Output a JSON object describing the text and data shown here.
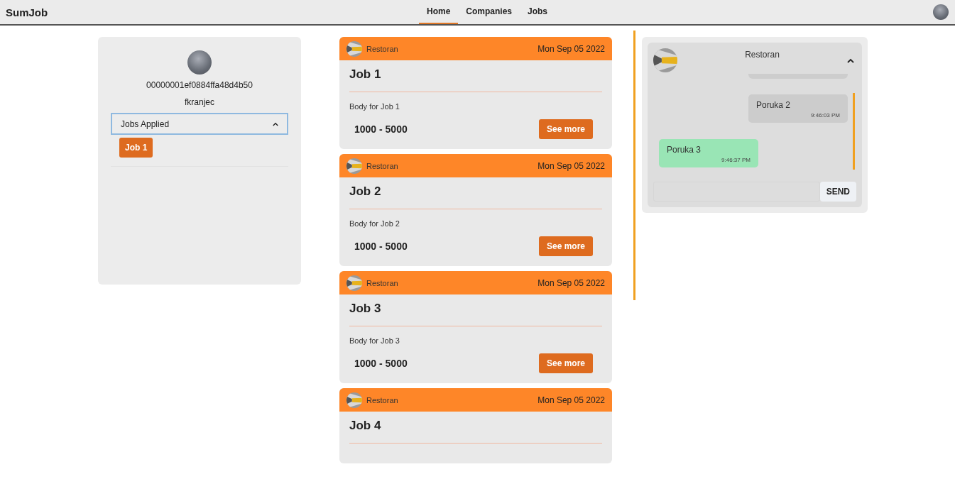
{
  "navbar": {
    "brand": "SumJob",
    "tabs": [
      {
        "label": "Home",
        "selected": true
      },
      {
        "label": "Companies",
        "selected": false
      },
      {
        "label": "Jobs",
        "selected": false
      }
    ]
  },
  "profile": {
    "user_id": "00000001ef0884ffa48d4b50",
    "username": "fkranjec",
    "accordion": {
      "label": "Jobs Applied",
      "expanded": true,
      "items": [
        "Job 1"
      ]
    }
  },
  "jobs": [
    {
      "company": "Restoran",
      "date": "Mon Sep 05 2022",
      "title": "Job 1",
      "body": "Body for Job 1",
      "salary": "1000 - 5000",
      "button": "See more"
    },
    {
      "company": "Restoran",
      "date": "Mon Sep 05 2022",
      "title": "Job 2",
      "body": "Body for Job 2",
      "salary": "1000 - 5000",
      "button": "See more"
    },
    {
      "company": "Restoran",
      "date": "Mon Sep 05 2022",
      "title": "Job 3",
      "body": "Body for Job 3",
      "salary": "1000 - 5000",
      "button": "See more"
    },
    {
      "company": "Restoran",
      "date": "Mon Sep 05 2022",
      "title": "Job 4"
    }
  ],
  "chat": {
    "title": "Restoran",
    "expanded": true,
    "messages": [
      {
        "kind": "sent",
        "text": "Poruka 2",
        "time": "9:46:03 PM"
      },
      {
        "kind": "received",
        "text": "Poruka 3",
        "time": "9:46:37 PM"
      }
    ],
    "send_button": "SEND"
  }
}
